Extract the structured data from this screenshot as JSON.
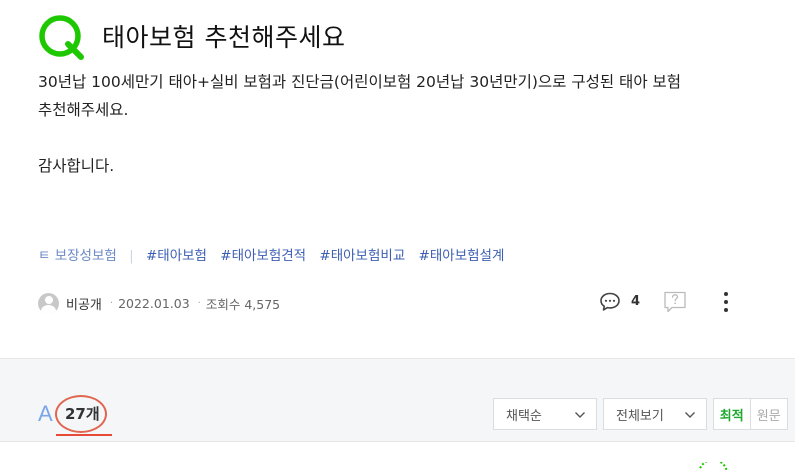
{
  "question": {
    "title": "태아보험 추천해주세요",
    "body_lines": [
      "30년납 100세만기 태아+실비 보험과 진단금(어린이보험 20년납 30년만기)으로 구성된 태아 보험",
      "추천해주세요.",
      "",
      "감사합니다."
    ],
    "tags_lead": "ㅌ 보장성보험",
    "tags": [
      "#태아보험",
      "#태아보험견적",
      "#태아보험비교",
      "#태아보험설계"
    ],
    "author": "비공개",
    "date": "2022.01.03",
    "views": "조회수 4,575",
    "comment_count": "4"
  },
  "answers": {
    "letter": "A",
    "count": "27개",
    "sort_select": "채택순",
    "view_select": "전체보기",
    "sort_options": [
      "최적",
      "원문"
    ]
  },
  "colors": {
    "brand_green": "#1ec800",
    "tag_blue": "#3d5fb3",
    "annotation_red": "#e84a3a"
  }
}
